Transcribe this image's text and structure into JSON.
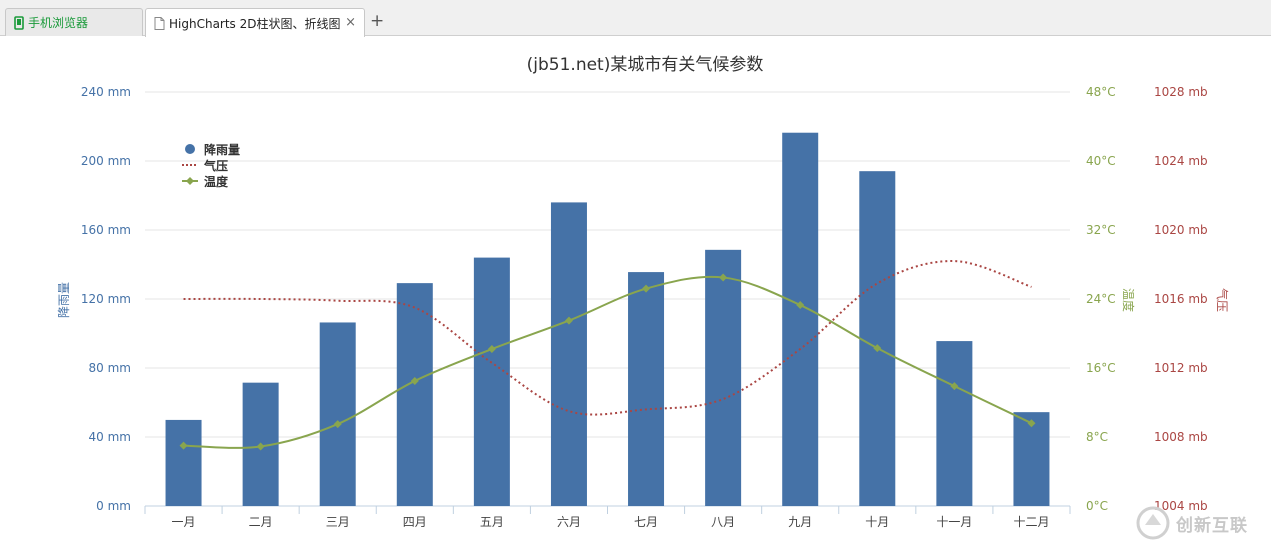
{
  "browser": {
    "tabs": [
      {
        "label": "手机浏览器"
      },
      {
        "label": "HighCharts 2D柱状图、折线图"
      }
    ],
    "close_glyph": "×",
    "new_tab_glyph": "+"
  },
  "watermark": {
    "text": "创新互联"
  },
  "chart_data": {
    "type": "bar",
    "title": "(jb51.net)某城市有关气候参数",
    "categories": [
      "一月",
      "二月",
      "三月",
      "四月",
      "五月",
      "六月",
      "七月",
      "八月",
      "九月",
      "十月",
      "十一月",
      "十二月"
    ],
    "series": [
      {
        "name": "降雨量",
        "type": "bar",
        "axis": "rain",
        "color": "#4572a7",
        "values": [
          49.9,
          71.5,
          106.4,
          129.2,
          144.0,
          176.0,
          135.6,
          148.5,
          216.4,
          194.1,
          95.6,
          54.4
        ]
      },
      {
        "name": "气压",
        "type": "spline",
        "axis": "pressure",
        "color": "#aa4643",
        "dashed": true,
        "values": [
          1016,
          1016,
          1015.9,
          1015.5,
          1012.3,
          1009.5,
          1009.6,
          1010.2,
          1013.1,
          1016.9,
          1018.2,
          1016.7
        ]
      },
      {
        "name": "温度",
        "type": "spline",
        "axis": "temperature",
        "color": "#89a54e",
        "marker": "diamond",
        "values": [
          7.0,
          6.9,
          9.5,
          14.5,
          18.2,
          21.5,
          25.2,
          26.5,
          23.3,
          18.3,
          13.9,
          9.6
        ]
      }
    ],
    "axes": {
      "rain": {
        "title": "降雨量",
        "min": 0,
        "max": 240,
        "step": 40,
        "ticks": [
          "0 mm",
          "40 mm",
          "80 mm",
          "120 mm",
          "160 mm",
          "200 mm",
          "240 mm"
        ],
        "color": "#4572a7"
      },
      "temperature": {
        "title": "温度",
        "min": 0,
        "max": 48,
        "step": 8,
        "ticks": [
          "0°C",
          "8°C",
          "16°C",
          "24°C",
          "32°C",
          "40°C",
          "48°C"
        ],
        "color": "#89a54e"
      },
      "pressure": {
        "title": "气压",
        "min": 1004,
        "max": 1028,
        "step": 4,
        "ticks": [
          "1004 mb",
          "1008 mb",
          "1012 mb",
          "1016 mb",
          "1020 mb",
          "1024 mb",
          "1028 mb"
        ],
        "color": "#aa4643"
      }
    },
    "legend_position": "top-left",
    "grid": true
  }
}
